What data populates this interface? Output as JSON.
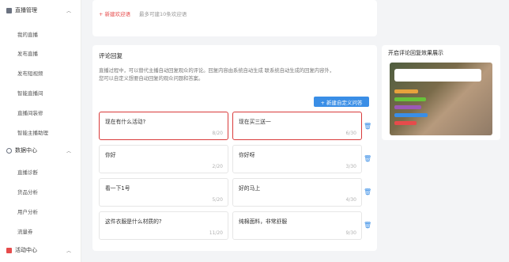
{
  "sidebar": {
    "groups": [
      {
        "label": "直播管理",
        "icon": "live-manage-icon",
        "color": "#5a6170",
        "expanded": true
      },
      {
        "label": "数据中心",
        "icon": "data-center-icon",
        "color": "#5a6170",
        "expanded": true
      },
      {
        "label": "活动中心",
        "icon": "activity-center-icon",
        "color": "#e64b4b",
        "expanded": true
      }
    ],
    "live_items": [
      "我的直播",
      "发布直播",
      "发布短视频",
      "智能直播间",
      "直播间装修",
      "智能主播助理"
    ],
    "data_items": [
      "直播诊断",
      "货品分析",
      "用户分析",
      "流量券"
    ]
  },
  "welcome": {
    "add_link": "+ 新建欢迎语",
    "note": "最多可建10条欢迎语"
  },
  "comment_reply": {
    "title": "评论回复",
    "description": "直播过程中，可以替代主播自动回复观众的评论。回复内容由系统自动生成 联系统自动生成的回复内容外，您可以自定义想要自动回复的观众问题和答案。",
    "new_button": "+ 新建自定义问答",
    "pairs": [
      {
        "question": "现在有什么活动?",
        "q_count": "8/20",
        "answer": "现在买三送一",
        "a_count": "6/30",
        "highlighted": true
      },
      {
        "question": "你好",
        "q_count": "2/20",
        "answer": "你好呀",
        "a_count": "3/30",
        "highlighted": false
      },
      {
        "question": "看一下1号",
        "q_count": "5/20",
        "answer": "好的马上",
        "a_count": "4/30",
        "highlighted": false
      },
      {
        "question": "这件衣服是什么材质的?",
        "q_count": "11/20",
        "answer": "纯棉面料，非常舒服",
        "a_count": "9/30",
        "highlighted": false
      }
    ]
  },
  "preview": {
    "title": "开启评论回复效果展示"
  },
  "colors": {
    "accent": "#3a8ee6",
    "highlight": "#d93a3a",
    "link": "#e64b4b"
  }
}
